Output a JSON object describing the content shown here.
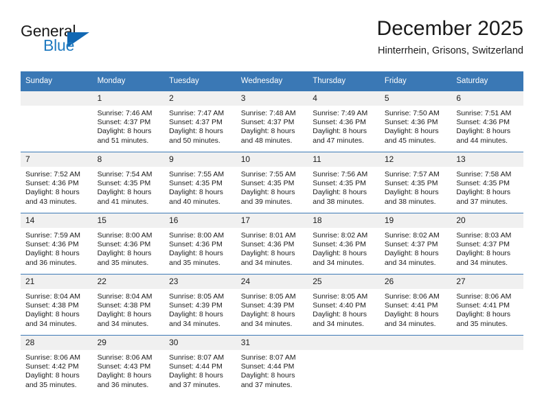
{
  "brand": {
    "name_part1": "General",
    "name_part2": "Blue",
    "triangle_icon": "blue-triangle-logo-icon",
    "colors": {
      "general": "#1a1a1a",
      "blue": "#1f7ac0",
      "triangle": "#1268b3"
    }
  },
  "header": {
    "month_title": "December 2025",
    "location": "Hinterrhein, Grisons, Switzerland"
  },
  "theme": {
    "header_blue": "#3a78b5",
    "daynum_band": "#f0f0f0",
    "text": "#1a1a1a"
  },
  "weekday_headers": [
    "Sunday",
    "Monday",
    "Tuesday",
    "Wednesday",
    "Thursday",
    "Friday",
    "Saturday"
  ],
  "weeks": [
    [
      {
        "day": "",
        "blank": true,
        "lines": [
          "",
          "",
          "",
          ""
        ]
      },
      {
        "day": "1",
        "blank": false,
        "lines": [
          "Sunrise: 7:46 AM",
          "Sunset: 4:37 PM",
          "Daylight: 8 hours",
          "and 51 minutes."
        ]
      },
      {
        "day": "2",
        "blank": false,
        "lines": [
          "Sunrise: 7:47 AM",
          "Sunset: 4:37 PM",
          "Daylight: 8 hours",
          "and 50 minutes."
        ]
      },
      {
        "day": "3",
        "blank": false,
        "lines": [
          "Sunrise: 7:48 AM",
          "Sunset: 4:37 PM",
          "Daylight: 8 hours",
          "and 48 minutes."
        ]
      },
      {
        "day": "4",
        "blank": false,
        "lines": [
          "Sunrise: 7:49 AM",
          "Sunset: 4:36 PM",
          "Daylight: 8 hours",
          "and 47 minutes."
        ]
      },
      {
        "day": "5",
        "blank": false,
        "lines": [
          "Sunrise: 7:50 AM",
          "Sunset: 4:36 PM",
          "Daylight: 8 hours",
          "and 45 minutes."
        ]
      },
      {
        "day": "6",
        "blank": false,
        "lines": [
          "Sunrise: 7:51 AM",
          "Sunset: 4:36 PM",
          "Daylight: 8 hours",
          "and 44 minutes."
        ]
      }
    ],
    [
      {
        "day": "7",
        "blank": false,
        "lines": [
          "Sunrise: 7:52 AM",
          "Sunset: 4:36 PM",
          "Daylight: 8 hours",
          "and 43 minutes."
        ]
      },
      {
        "day": "8",
        "blank": false,
        "lines": [
          "Sunrise: 7:54 AM",
          "Sunset: 4:35 PM",
          "Daylight: 8 hours",
          "and 41 minutes."
        ]
      },
      {
        "day": "9",
        "blank": false,
        "lines": [
          "Sunrise: 7:55 AM",
          "Sunset: 4:35 PM",
          "Daylight: 8 hours",
          "and 40 minutes."
        ]
      },
      {
        "day": "10",
        "blank": false,
        "lines": [
          "Sunrise: 7:55 AM",
          "Sunset: 4:35 PM",
          "Daylight: 8 hours",
          "and 39 minutes."
        ]
      },
      {
        "day": "11",
        "blank": false,
        "lines": [
          "Sunrise: 7:56 AM",
          "Sunset: 4:35 PM",
          "Daylight: 8 hours",
          "and 38 minutes."
        ]
      },
      {
        "day": "12",
        "blank": false,
        "lines": [
          "Sunrise: 7:57 AM",
          "Sunset: 4:35 PM",
          "Daylight: 8 hours",
          "and 38 minutes."
        ]
      },
      {
        "day": "13",
        "blank": false,
        "lines": [
          "Sunrise: 7:58 AM",
          "Sunset: 4:35 PM",
          "Daylight: 8 hours",
          "and 37 minutes."
        ]
      }
    ],
    [
      {
        "day": "14",
        "blank": false,
        "lines": [
          "Sunrise: 7:59 AM",
          "Sunset: 4:36 PM",
          "Daylight: 8 hours",
          "and 36 minutes."
        ]
      },
      {
        "day": "15",
        "blank": false,
        "lines": [
          "Sunrise: 8:00 AM",
          "Sunset: 4:36 PM",
          "Daylight: 8 hours",
          "and 35 minutes."
        ]
      },
      {
        "day": "16",
        "blank": false,
        "lines": [
          "Sunrise: 8:00 AM",
          "Sunset: 4:36 PM",
          "Daylight: 8 hours",
          "and 35 minutes."
        ]
      },
      {
        "day": "17",
        "blank": false,
        "lines": [
          "Sunrise: 8:01 AM",
          "Sunset: 4:36 PM",
          "Daylight: 8 hours",
          "and 34 minutes."
        ]
      },
      {
        "day": "18",
        "blank": false,
        "lines": [
          "Sunrise: 8:02 AM",
          "Sunset: 4:36 PM",
          "Daylight: 8 hours",
          "and 34 minutes."
        ]
      },
      {
        "day": "19",
        "blank": false,
        "lines": [
          "Sunrise: 8:02 AM",
          "Sunset: 4:37 PM",
          "Daylight: 8 hours",
          "and 34 minutes."
        ]
      },
      {
        "day": "20",
        "blank": false,
        "lines": [
          "Sunrise: 8:03 AM",
          "Sunset: 4:37 PM",
          "Daylight: 8 hours",
          "and 34 minutes."
        ]
      }
    ],
    [
      {
        "day": "21",
        "blank": false,
        "lines": [
          "Sunrise: 8:04 AM",
          "Sunset: 4:38 PM",
          "Daylight: 8 hours",
          "and 34 minutes."
        ]
      },
      {
        "day": "22",
        "blank": false,
        "lines": [
          "Sunrise: 8:04 AM",
          "Sunset: 4:38 PM",
          "Daylight: 8 hours",
          "and 34 minutes."
        ]
      },
      {
        "day": "23",
        "blank": false,
        "lines": [
          "Sunrise: 8:05 AM",
          "Sunset: 4:39 PM",
          "Daylight: 8 hours",
          "and 34 minutes."
        ]
      },
      {
        "day": "24",
        "blank": false,
        "lines": [
          "Sunrise: 8:05 AM",
          "Sunset: 4:39 PM",
          "Daylight: 8 hours",
          "and 34 minutes."
        ]
      },
      {
        "day": "25",
        "blank": false,
        "lines": [
          "Sunrise: 8:05 AM",
          "Sunset: 4:40 PM",
          "Daylight: 8 hours",
          "and 34 minutes."
        ]
      },
      {
        "day": "26",
        "blank": false,
        "lines": [
          "Sunrise: 8:06 AM",
          "Sunset: 4:41 PM",
          "Daylight: 8 hours",
          "and 34 minutes."
        ]
      },
      {
        "day": "27",
        "blank": false,
        "lines": [
          "Sunrise: 8:06 AM",
          "Sunset: 4:41 PM",
          "Daylight: 8 hours",
          "and 35 minutes."
        ]
      }
    ],
    [
      {
        "day": "28",
        "blank": false,
        "lines": [
          "Sunrise: 8:06 AM",
          "Sunset: 4:42 PM",
          "Daylight: 8 hours",
          "and 35 minutes."
        ]
      },
      {
        "day": "29",
        "blank": false,
        "lines": [
          "Sunrise: 8:06 AM",
          "Sunset: 4:43 PM",
          "Daylight: 8 hours",
          "and 36 minutes."
        ]
      },
      {
        "day": "30",
        "blank": false,
        "lines": [
          "Sunrise: 8:07 AM",
          "Sunset: 4:44 PM",
          "Daylight: 8 hours",
          "and 37 minutes."
        ]
      },
      {
        "day": "31",
        "blank": false,
        "lines": [
          "Sunrise: 8:07 AM",
          "Sunset: 4:44 PM",
          "Daylight: 8 hours",
          "and 37 minutes."
        ]
      },
      {
        "day": "",
        "blank": true,
        "lines": [
          "",
          "",
          "",
          ""
        ]
      },
      {
        "day": "",
        "blank": true,
        "lines": [
          "",
          "",
          "",
          ""
        ]
      },
      {
        "day": "",
        "blank": true,
        "lines": [
          "",
          "",
          "",
          ""
        ]
      }
    ]
  ]
}
